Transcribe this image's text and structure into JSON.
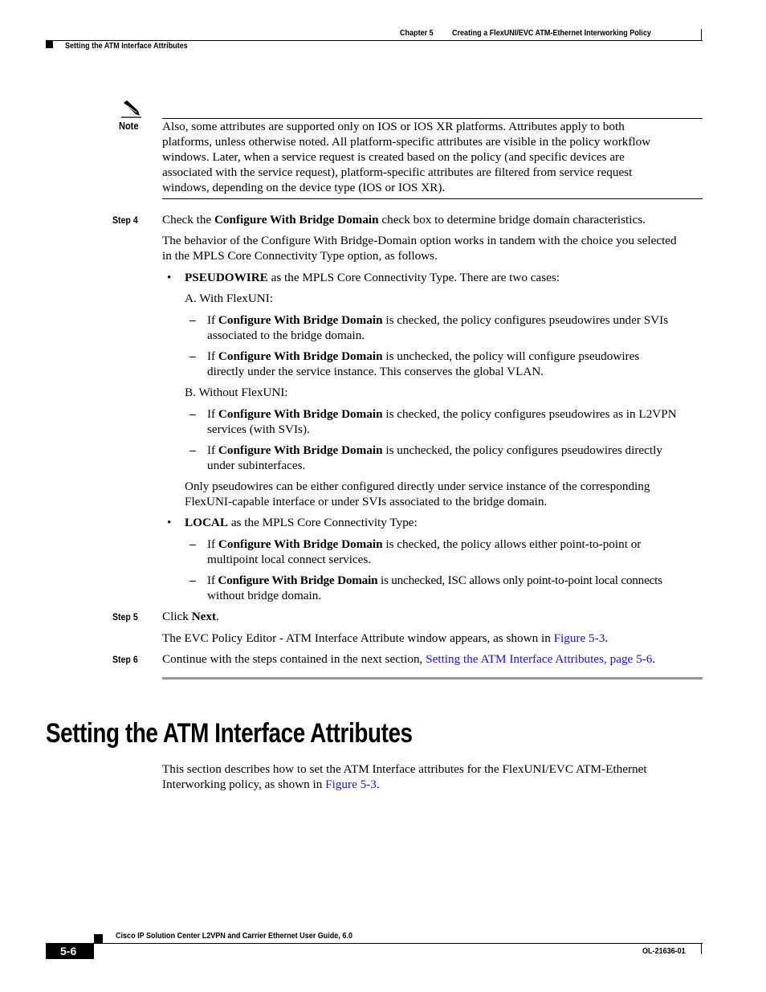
{
  "header": {
    "chapter": "Chapter 5",
    "chapter_title": "Creating a FlexUNI/EVC ATM-Ethernet Interworking Policy",
    "section": "Setting the ATM Interface Attributes"
  },
  "note": {
    "icon": "pencil-icon",
    "label": "Note",
    "lines": [
      "Also, some attributes are supported only on IOS or IOS XR platforms. Attributes apply to both",
      "platforms, unless otherwise noted. All platform-specific attributes are visible in the policy workflow",
      "windows. Later, when a service request is created based on the policy (and specific devices are",
      "associated with the service request), platform-specific attributes are filtered from service request",
      "windows, depending on the device type (IOS or IOS XR)."
    ]
  },
  "step4": {
    "label": "Step 4",
    "pre": "Check the ",
    "bold": "Configure With Bridge Domain",
    "post": " check box to determine bridge domain characteristics.",
    "para_lines": [
      "The behavior of the Configure With Bridge-Domain option works in tandem with the choice you selected",
      "in the MPLS Core Connectivity Type option, as follows."
    ],
    "bullet1": {
      "bold": "PSEUDOWIRE",
      "text": " as the MPLS Core Connectivity Type. There are two cases:",
      "case_a": "A. With FlexUNI:",
      "case_a_items": [
        {
          "pre": "If ",
          "bold": "Configure With Bridge Domain",
          "line1": " is checked, the policy configures pseudowires under SVIs",
          "line2": "associated to the bridge domain."
        },
        {
          "pre": "If ",
          "bold": "Configure With Bridge Domain",
          "line1": " is unchecked, the policy will configure pseudowires",
          "line2": "directly under the service instance. This conserves the global VLAN."
        }
      ],
      "case_b": "B. Without FlexUNI:",
      "case_b_items": [
        {
          "pre": "If ",
          "bold": "Configure With Bridge Domain",
          "line1": " is checked, the policy configures pseudowires as in L2VPN",
          "line2": "services (with SVIs)."
        },
        {
          "pre": "If ",
          "bold": "Configure With Bridge Domain",
          "line1": " is unchecked, the policy configures pseudowires directly",
          "line2": "under subinterfaces."
        }
      ],
      "only_lines": [
        "Only pseudowires can be either configured directly under service instance of the corresponding",
        "FlexUNI-capable interface or under SVIs associated to the bridge domain."
      ]
    },
    "bullet2": {
      "bold": "LOCAL",
      "text": " as the MPLS Core Connectivity Type:",
      "items": [
        {
          "pre": "If ",
          "bold": "Configure With Bridge Domain",
          "line1": " is checked, the policy allows either point-to-point or",
          "line2": "multipoint local connect services."
        },
        {
          "pre": "If ",
          "bold": "Configure With Bridge Domain",
          "line1": " is unchecked, ISC allows only point-to-point local connects",
          "line2": "without bridge domain."
        }
      ]
    }
  },
  "step5": {
    "label": "Step 5",
    "pre": "Click ",
    "bold": "Next",
    "post": ".",
    "para_pre": "The EVC Policy Editor - ATM Interface Attribute window appears, as shown in ",
    "para_link": "Figure 5-3",
    "para_post": "."
  },
  "step6": {
    "label": "Step 6",
    "pre": "Continue with the steps contained in the next section, ",
    "link": "Setting the ATM Interface Attributes, page 5-6",
    "post": "."
  },
  "section": {
    "title": "Setting the ATM Interface Attributes",
    "line1": "This section describes how to set the ATM Interface attributes for the FlexUNI/EVC ATM-Ethernet",
    "line2_pre": "Interworking policy, as shown in ",
    "line2_link": "Figure 5-3",
    "line2_post": "."
  },
  "footer": {
    "guide_title": "Cisco IP Solution Center L2VPN and Carrier Ethernet User Guide, 6.0",
    "page_number": "5-6",
    "doc_id": "OL-21636-01"
  },
  "colors": {
    "link": "#1a0dff",
    "rule_gray": "#999999"
  }
}
